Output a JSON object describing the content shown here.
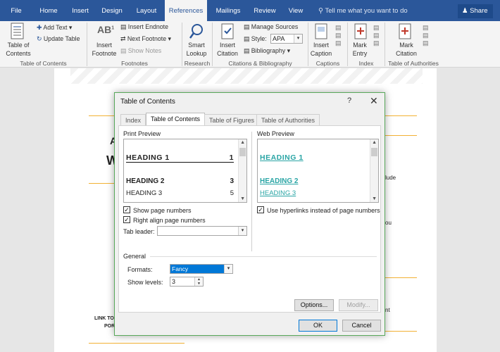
{
  "ribbon_tabs": [
    "File",
    "Home",
    "Insert",
    "Design",
    "Layout",
    "References",
    "Mailings",
    "Review",
    "View"
  ],
  "tell_me": "Tell me what you want to do",
  "share": "Share",
  "ribbon": {
    "toc_label": "Table of\nContents",
    "add_text": "Add Text",
    "update_table": "Update Table",
    "insert_footnote": "Insert\nFootnote",
    "insert_endnote": "Insert Endnote",
    "next_footnote": "Next Footnote",
    "show_notes": "Show Notes",
    "smart_lookup": "Smart\nLookup",
    "insert_citation": "Insert\nCitation",
    "manage_sources": "Manage Sources",
    "style_label": "Style:",
    "style_value": "APA",
    "bibliography": "Bibliography",
    "insert_caption": "Insert\nCaption",
    "mark_entry": "Mark\nEntry",
    "mark_citation": "Mark\nCitation",
    "groups": [
      "Table of Contents",
      "Footnotes",
      "Research",
      "Citations & Bibliography",
      "Captions",
      "Index",
      "Table of Authorities"
    ]
  },
  "doc_fragments": {
    "left_big_1": "A",
    "left_big_2": "W",
    "right_1": "lude",
    "right_2": "ou",
    "right_3": "nt",
    "bottom_1": "LINK TO",
    "bottom_2": "POR"
  },
  "dialog": {
    "title": "Table of Contents",
    "help": "?",
    "close": "✕",
    "tabs": [
      "Index",
      "Table of Contents",
      "Table of Figures",
      "Table of Authorities"
    ],
    "print_preview": "Print Preview",
    "web_preview": "Web Preview",
    "print_entries": [
      {
        "text": "HEADING 1",
        "page": "1"
      },
      {
        "text": "HEADING 2",
        "page": "3"
      },
      {
        "text": "HEADING 3",
        "page": "5"
      }
    ],
    "web_entries": [
      "HEADING 1",
      "HEADING 2",
      "HEADING 3"
    ],
    "show_page_numbers": "Show page numbers",
    "right_align": "Right align page numbers",
    "tab_leader": "Tab leader:",
    "tab_leader_value": "",
    "use_hyperlinks": "Use hyperlinks instead of page numbers",
    "general": "General",
    "formats": "Formats:",
    "formats_value": "Fancy",
    "show_levels": "Show levels:",
    "show_levels_value": "3",
    "options": "Options...",
    "modify": "Modify...",
    "ok": "OK",
    "cancel": "Cancel"
  },
  "colors": {
    "ribbon_blue": "#2b579a",
    "link_teal": "#2aa5a5",
    "accent_orange": "#f2b134"
  }
}
